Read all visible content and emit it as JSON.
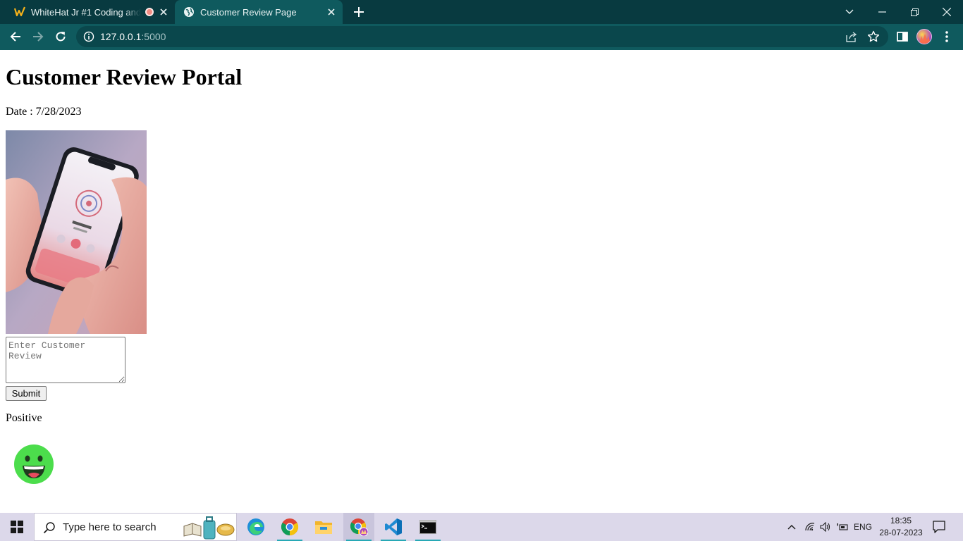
{
  "browser": {
    "tabs": [
      {
        "title": "WhiteHat Jr #1 Coding and F",
        "active": false,
        "recording": true
      },
      {
        "title": "Customer Review Page",
        "active": true
      }
    ],
    "url": {
      "host": "127.0.0.1",
      "port": ":5000"
    },
    "icons": {
      "back": "arrow-left-icon",
      "forward": "arrow-right-icon",
      "reload": "reload-icon",
      "site_info": "info-icon",
      "share": "share-icon",
      "bookmark": "star-icon",
      "side_panel": "side-panel-icon",
      "profile": "avatar",
      "menu": "kebab-menu-icon"
    }
  },
  "page": {
    "title": "Customer Review Portal",
    "date_text": "Date : 7/28/2023",
    "review_placeholder": "Enter Customer Review",
    "submit_label": "Submit",
    "sentiment": "Positive",
    "sentiment_emoji": "grinning-face-icon"
  },
  "taskbar": {
    "search_placeholder": "Type here to search",
    "apps": [
      "edge-icon",
      "chrome-icon",
      "file-explorer-icon",
      "chrome-profile-icon",
      "vscode-icon",
      "terminal-icon"
    ],
    "language": "ENG",
    "time": "18:35",
    "date": "28-07-2023"
  },
  "colors": {
    "tabstrip": "#083a40",
    "toolbar": "#0f5a5e",
    "omnibox": "#0a474c",
    "taskbar": "#dcd8ea",
    "emoji_face": "#4cdd4c"
  }
}
